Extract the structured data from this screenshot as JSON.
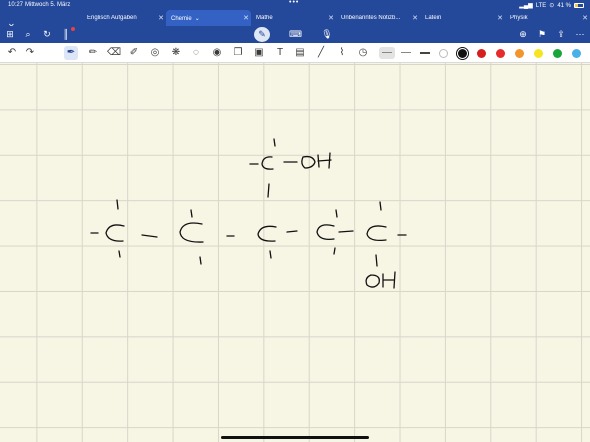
{
  "status": {
    "time": "10:27",
    "date": "Mittwoch 5. März",
    "network": "LTE",
    "battery": "41 %",
    "battery_level": 0.41
  },
  "tabs": [
    {
      "label": "Englisch Aufgaben",
      "active": false
    },
    {
      "label": "Chemie",
      "active": true
    },
    {
      "label": "Mathe",
      "active": false
    },
    {
      "label": "Unbenanntes Notizb...",
      "active": false
    },
    {
      "label": "Latein",
      "active": false
    },
    {
      "label": "Physik",
      "active": false
    }
  ],
  "navbar": {
    "icons": [
      "grid-icon",
      "search-icon",
      "rotate-icon",
      "audio-icon",
      "pencil-mode-icon",
      "keyboard-icon",
      "mic-icon",
      "add-page-icon",
      "bookmark-icon",
      "share-icon",
      "more-icon"
    ]
  },
  "toolbar": {
    "tools": [
      "undo-icon",
      "redo-icon",
      "pen-icon",
      "pencil-icon",
      "eraser-icon",
      "highlighter-icon",
      "shape-icon",
      "elements-icon",
      "lasso-icon",
      "laser-icon",
      "sticker-icon",
      "image-icon",
      "text-icon",
      "scan-icon",
      "ruler-icon",
      "pipette-icon",
      "timer-icon"
    ],
    "colors": [
      {
        "name": "white",
        "hex": "#ffffff"
      },
      {
        "name": "black",
        "hex": "#111111",
        "selected": true
      },
      {
        "name": "dark-red",
        "hex": "#d51f1f"
      },
      {
        "name": "red",
        "hex": "#e72b2b"
      },
      {
        "name": "orange",
        "hex": "#f2952c"
      },
      {
        "name": "yellow",
        "hex": "#f5e61f"
      },
      {
        "name": "green",
        "hex": "#1aa53a"
      },
      {
        "name": "light-blue",
        "hex": "#49b0ea"
      }
    ]
  },
  "note": {
    "handwriting": [
      "-C-OH",
      "OH"
    ]
  }
}
